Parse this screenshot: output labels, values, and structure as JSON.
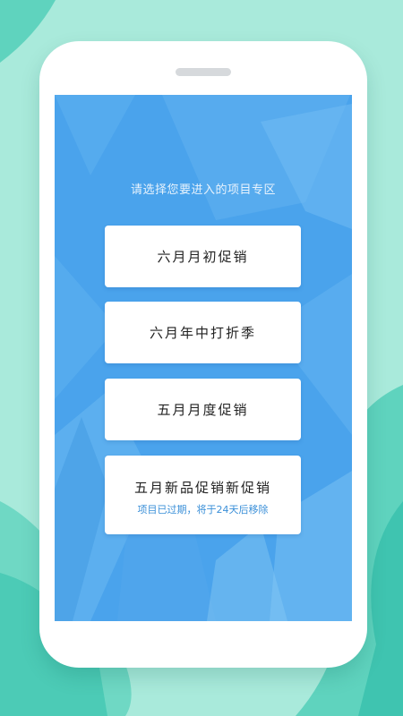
{
  "colors": {
    "background": "#a9eadb",
    "background_accent": "#3fc4b0",
    "screen": "#4aa3ec",
    "card": "#ffffff",
    "card_text": "#222222",
    "note_text": "#3a8fd8"
  },
  "screen": {
    "prompt": "请选择您要进入的项目专区"
  },
  "options": [
    {
      "label": "六月月初促销",
      "note": ""
    },
    {
      "label": "六月年中打折季",
      "note": ""
    },
    {
      "label": "五月月度促销",
      "note": ""
    },
    {
      "label": "五月新品促销新促销",
      "note": "项目已过期，将于24天后移除"
    }
  ]
}
